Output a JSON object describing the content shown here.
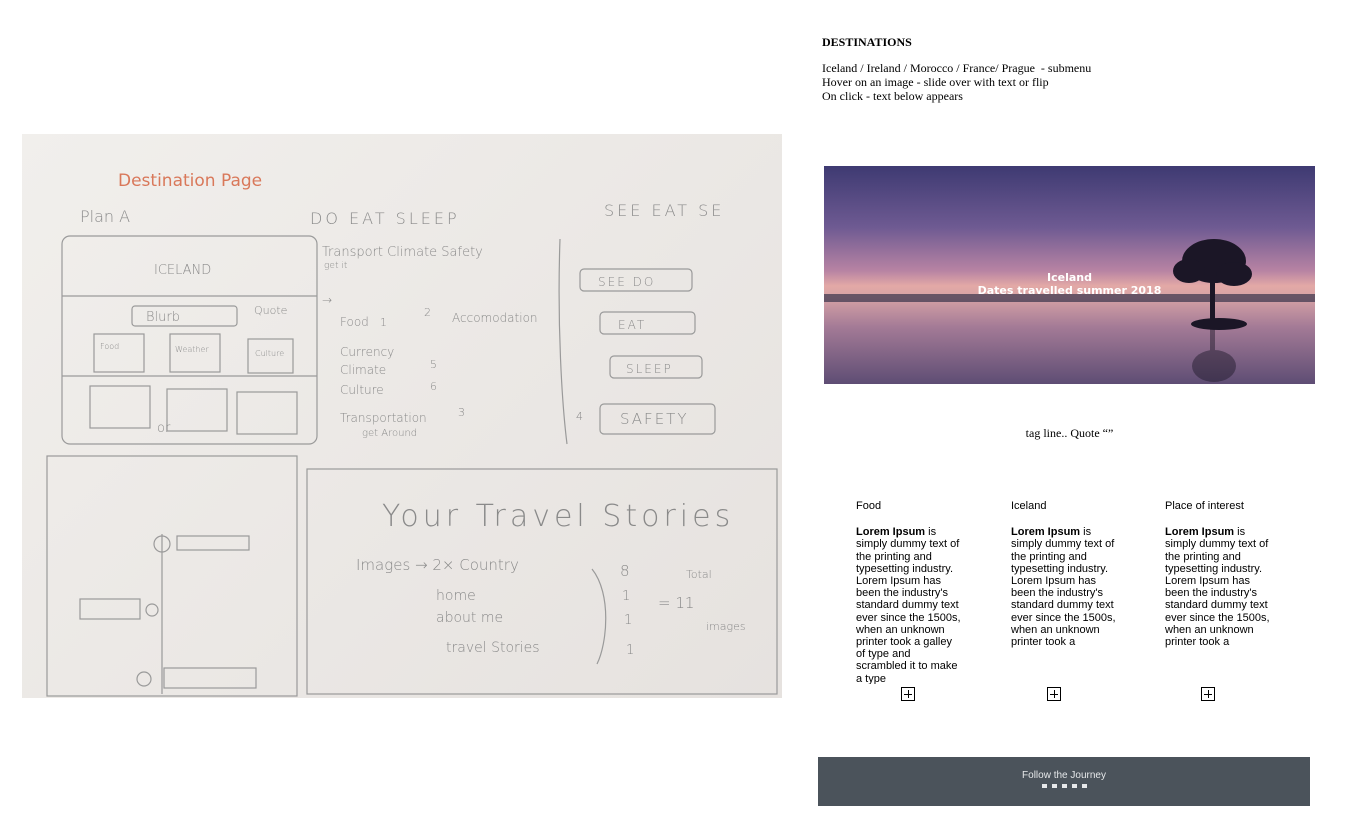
{
  "sketch": {
    "title": "Destination Page",
    "plan": "Plan A",
    "nav_primary": "DO EAT SLEEP",
    "nav_alt": "SEE EAT SE",
    "sub_tabs": "Transport Climate Safety",
    "sub_tabs_note": "get it",
    "hero_label": "ICELAND",
    "blurb": "Blurb",
    "blurb_note": "Quote",
    "boxes": [
      "Food",
      "Weather",
      "Culture"
    ],
    "or_note": "or",
    "list_items": [
      "Food",
      "Currency",
      "Climate",
      "Culture",
      "Transportation"
    ],
    "list_numbers": [
      "1",
      "5",
      "6",
      "3"
    ],
    "list_note": "get Around",
    "accommodation": "Accomodation",
    "accommodation_number": "2",
    "side_buttons": [
      "SEE DO",
      "EAT",
      "SLEEP",
      "SAFETY"
    ],
    "safety_number": "4",
    "stories_title": "Your Travel Stories",
    "stories_images": "Images → 2× Country",
    "stories_items": [
      "home",
      "about me",
      "travel Stories"
    ],
    "stories_counts": [
      "8",
      "1",
      "1",
      "1"
    ],
    "stories_total_label": "Total",
    "stories_total_eq": "= 11",
    "stories_images_label": "images"
  },
  "notes": {
    "title": "DESTINATIONS",
    "lines": [
      "Iceland / Ireland / Morocco / France/ Prague  - submenu",
      "Hover on an image - slide over with text or flip",
      "On click - text below appears"
    ]
  },
  "hero": {
    "line1": "Iceland",
    "line2": "Dates travelled summer 2018"
  },
  "tagline": "tag line.. Quote “”",
  "columns": [
    {
      "title": "Food",
      "lead": "Lorem Ipsum",
      "text": " is simply dummy text of the printing and typesetting industry. Lorem Ipsum has been the industry's standard dummy text ever since the 1500s, when an unknown printer took a galley of type and scrambled it to make a type"
    },
    {
      "title": "Iceland",
      "lead": "Lorem Ipsum",
      "text": " is simply dummy text of the printing and typesetting industry. Lorem Ipsum has been the industry's standard dummy text ever since the 1500s, when an unknown printer took a"
    },
    {
      "title": "Place of interest",
      "lead": "Lorem Ipsum",
      "text": " is simply dummy text of the printing and typesetting industry. Lorem Ipsum has been the industry's standard dummy text ever since the 1500s, when an unknown printer took a"
    }
  ],
  "footer": {
    "title": "Follow the Journey",
    "icons": [
      "facebook-icon",
      "instagram-icon",
      "person-icon",
      "twitter-icon",
      "youtube-icon"
    ]
  }
}
